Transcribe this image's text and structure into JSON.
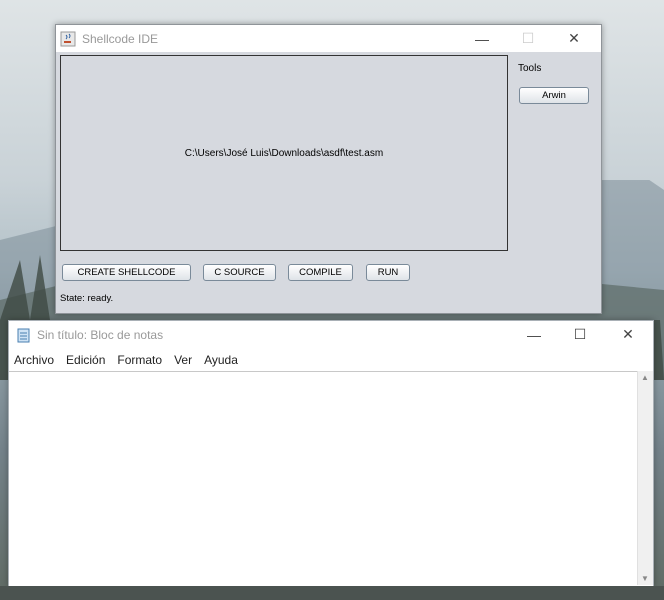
{
  "java_window": {
    "title": "Shellcode IDE",
    "editor_text": "C:\\Users\\José Luis\\Downloads\\asdf\\test.asm",
    "tools_label": "Tools",
    "tool_button": "Arwin",
    "buttons": {
      "create_shellcode": "CREATE SHELLCODE",
      "c_source": "C SOURCE",
      "compile": "COMPILE",
      "run": "RUN"
    },
    "state": "State: ready."
  },
  "notepad": {
    "title": "Sin título: Bloc de notas",
    "menu": [
      "Archivo",
      "Edición",
      "Formato",
      "Ver",
      "Ayuda"
    ]
  }
}
